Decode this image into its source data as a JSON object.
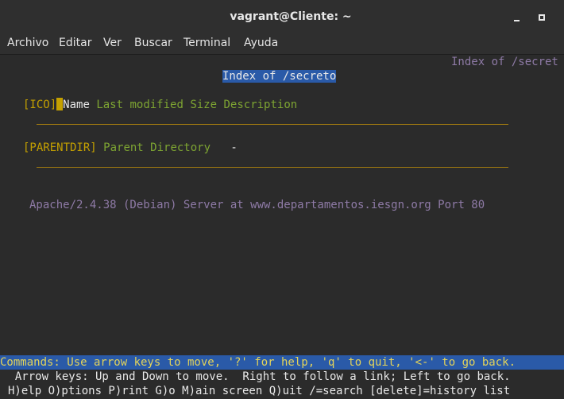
{
  "window": {
    "title": "vagrant@Cliente: ~"
  },
  "menu": {
    "items": [
      "Archivo",
      "Editar",
      "Ver",
      "Buscar",
      "Terminal",
      "Ayuda"
    ]
  },
  "page": {
    "corner_title": "Index of /secret",
    "heading": "Index of /secreto",
    "columns": {
      "icon": "[ICO]",
      "name": "Name",
      "last_modified": "Last modified",
      "size": "Size",
      "description": "Description"
    },
    "parent_row": {
      "icon": "[PARENTDIR]",
      "link": "Parent Directory",
      "size": "-"
    },
    "server_signature": "Apache/2.4.38 (Debian) Server at www.departamentos.iesgn.org Port 80"
  },
  "lynx": {
    "status": "Commands: Use arrow keys to move, '?' for help, 'q' to quit, '<-' to go back.",
    "help_line_1": "  Arrow keys: Up and Down to move.  Right to follow a link; Left to go back.",
    "help_line_2": "H)elp O)ptions P)rint G)o M)ain screen Q)uit /=search [delete]=history list"
  },
  "colors": {
    "background": "#2b2b2b",
    "status_bar": "#2a5aa8",
    "link_green": "#7ea532",
    "bracket_yellow": "#c4a000",
    "text_purple": "#8e7aa6"
  }
}
